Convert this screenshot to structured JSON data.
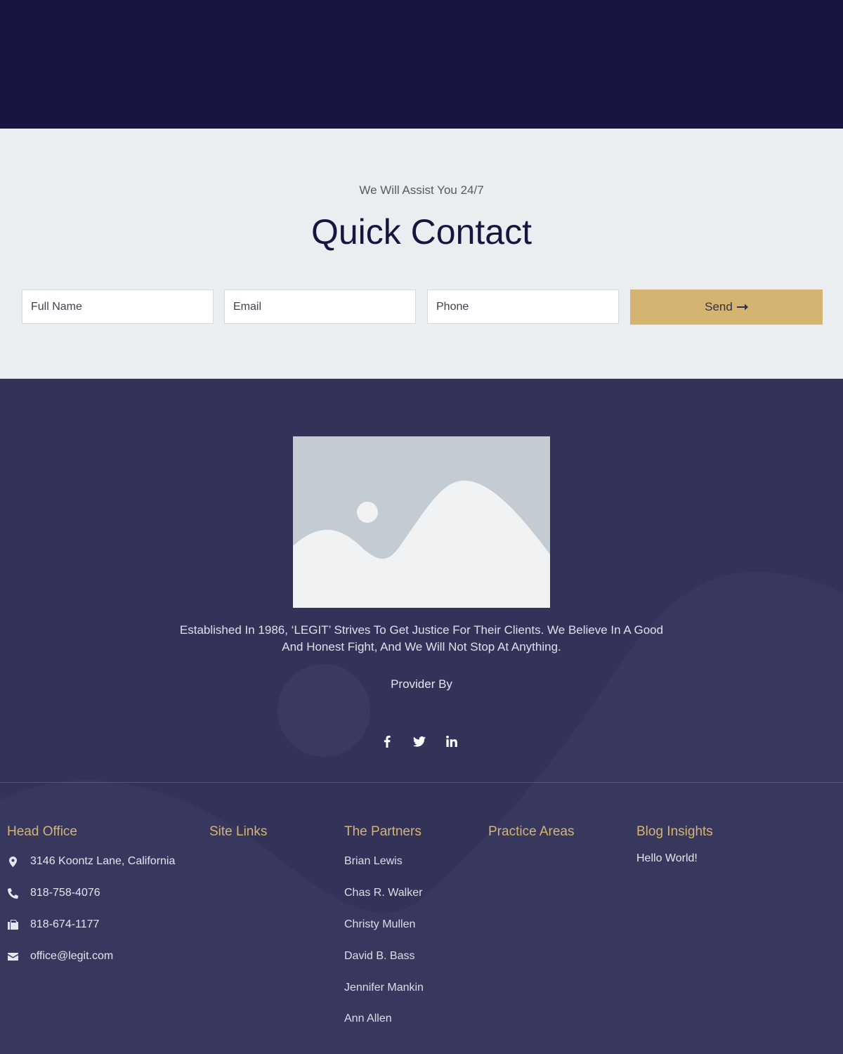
{
  "contact": {
    "eyebrow": "We Will Assist You 24/7",
    "heading": "Quick Contact",
    "name_placeholder": "Full Name",
    "email_placeholder": "Email",
    "phone_placeholder": "Phone",
    "send_label": "Send",
    "send_icon": "arrow-right-icon"
  },
  "footer": {
    "about": "Established In 1986, ‘LEGIT’ Strives To Get Justice For Their Clients. We Believe In A Good And Honest Fight, And We Will Not Stop At Anything.",
    "provider": "Provider By",
    "social": [
      "facebook-icon",
      "twitter-icon",
      "linkedin-icon"
    ],
    "head_office": {
      "title": "Head Office",
      "address": "3146 Koontz Lane, California",
      "phone": "818-758-4076",
      "fax": "818-674-1177",
      "email": "office@legit.com"
    },
    "site_links": {
      "title": "Site Links"
    },
    "partners": {
      "title": "The Partners",
      "items": [
        "Brian Lewis",
        "Chas R. Walker",
        "Christy Mullen",
        "David B. Bass",
        "Jennifer Mankin",
        "Ann Allen"
      ]
    },
    "practice_areas": {
      "title": "Practice Areas"
    },
    "blog": {
      "title": "Blog Insights",
      "items": [
        "Hello World!"
      ]
    }
  },
  "colors": {
    "top_band": "#171640",
    "contact_bg": "#ebeef1",
    "footer_bg": "#33335a",
    "accent_gold": "#d4b470",
    "heading_navy": "#171640"
  }
}
